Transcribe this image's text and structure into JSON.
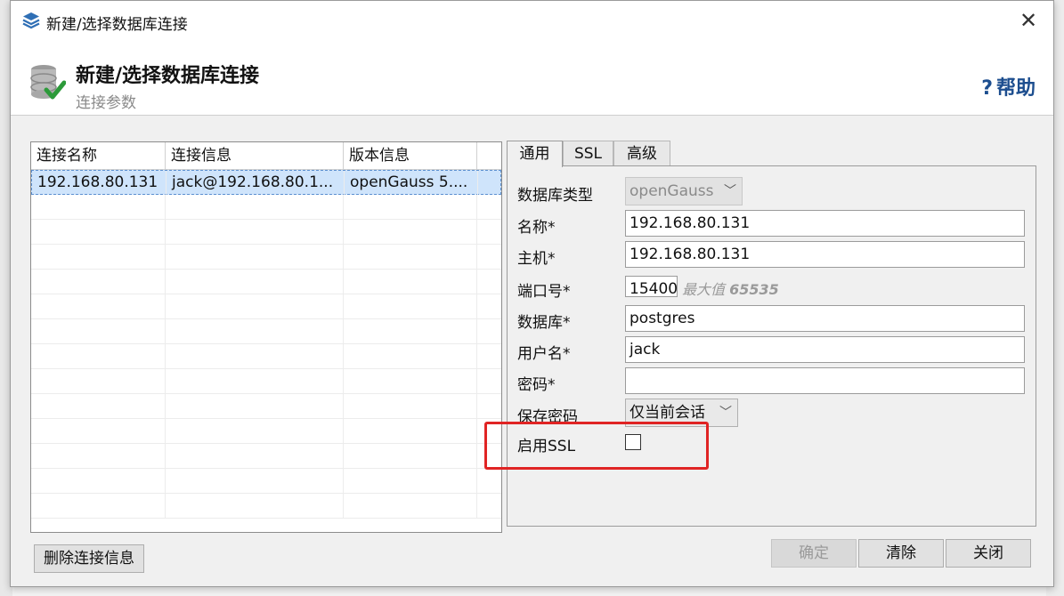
{
  "window": {
    "title": "新建/选择数据库连接"
  },
  "header": {
    "title": "新建/选择数据库连接",
    "subtitle": "连接参数",
    "help": "帮助"
  },
  "table": {
    "columns": [
      "连接名称",
      "连接信息",
      "版本信息"
    ],
    "rows": [
      {
        "name": "192.168.80.131",
        "info": "jack@192.168.80.1...",
        "version": "openGauss 5...."
      }
    ]
  },
  "tabs": [
    "通用",
    "SSL",
    "高级"
  ],
  "form": {
    "db_type_label": "数据库类型",
    "db_type_value": "openGauss",
    "name_label": "名称*",
    "name_value": "192.168.80.131",
    "host_label": "主机*",
    "host_value": "192.168.80.131",
    "port_label": "端口号*",
    "port_value": "15400",
    "port_hint_text": "最大值",
    "port_hint_value": "65535",
    "database_label": "数据库*",
    "database_value": "postgres",
    "user_label": "用户名*",
    "user_value": "jack",
    "password_label": "密码*",
    "password_value": "",
    "save_password_label": "保存密码",
    "save_password_value": "仅当前会话",
    "enable_ssl_label": "启用SSL",
    "enable_ssl_checked": false
  },
  "buttons": {
    "delete": "删除连接信息",
    "ok": "确定",
    "clear": "清除",
    "close": "关闭"
  },
  "colors": {
    "highlight": "#e02424",
    "help": "#1d4e8f",
    "selected_row": "#cfe4fb"
  }
}
